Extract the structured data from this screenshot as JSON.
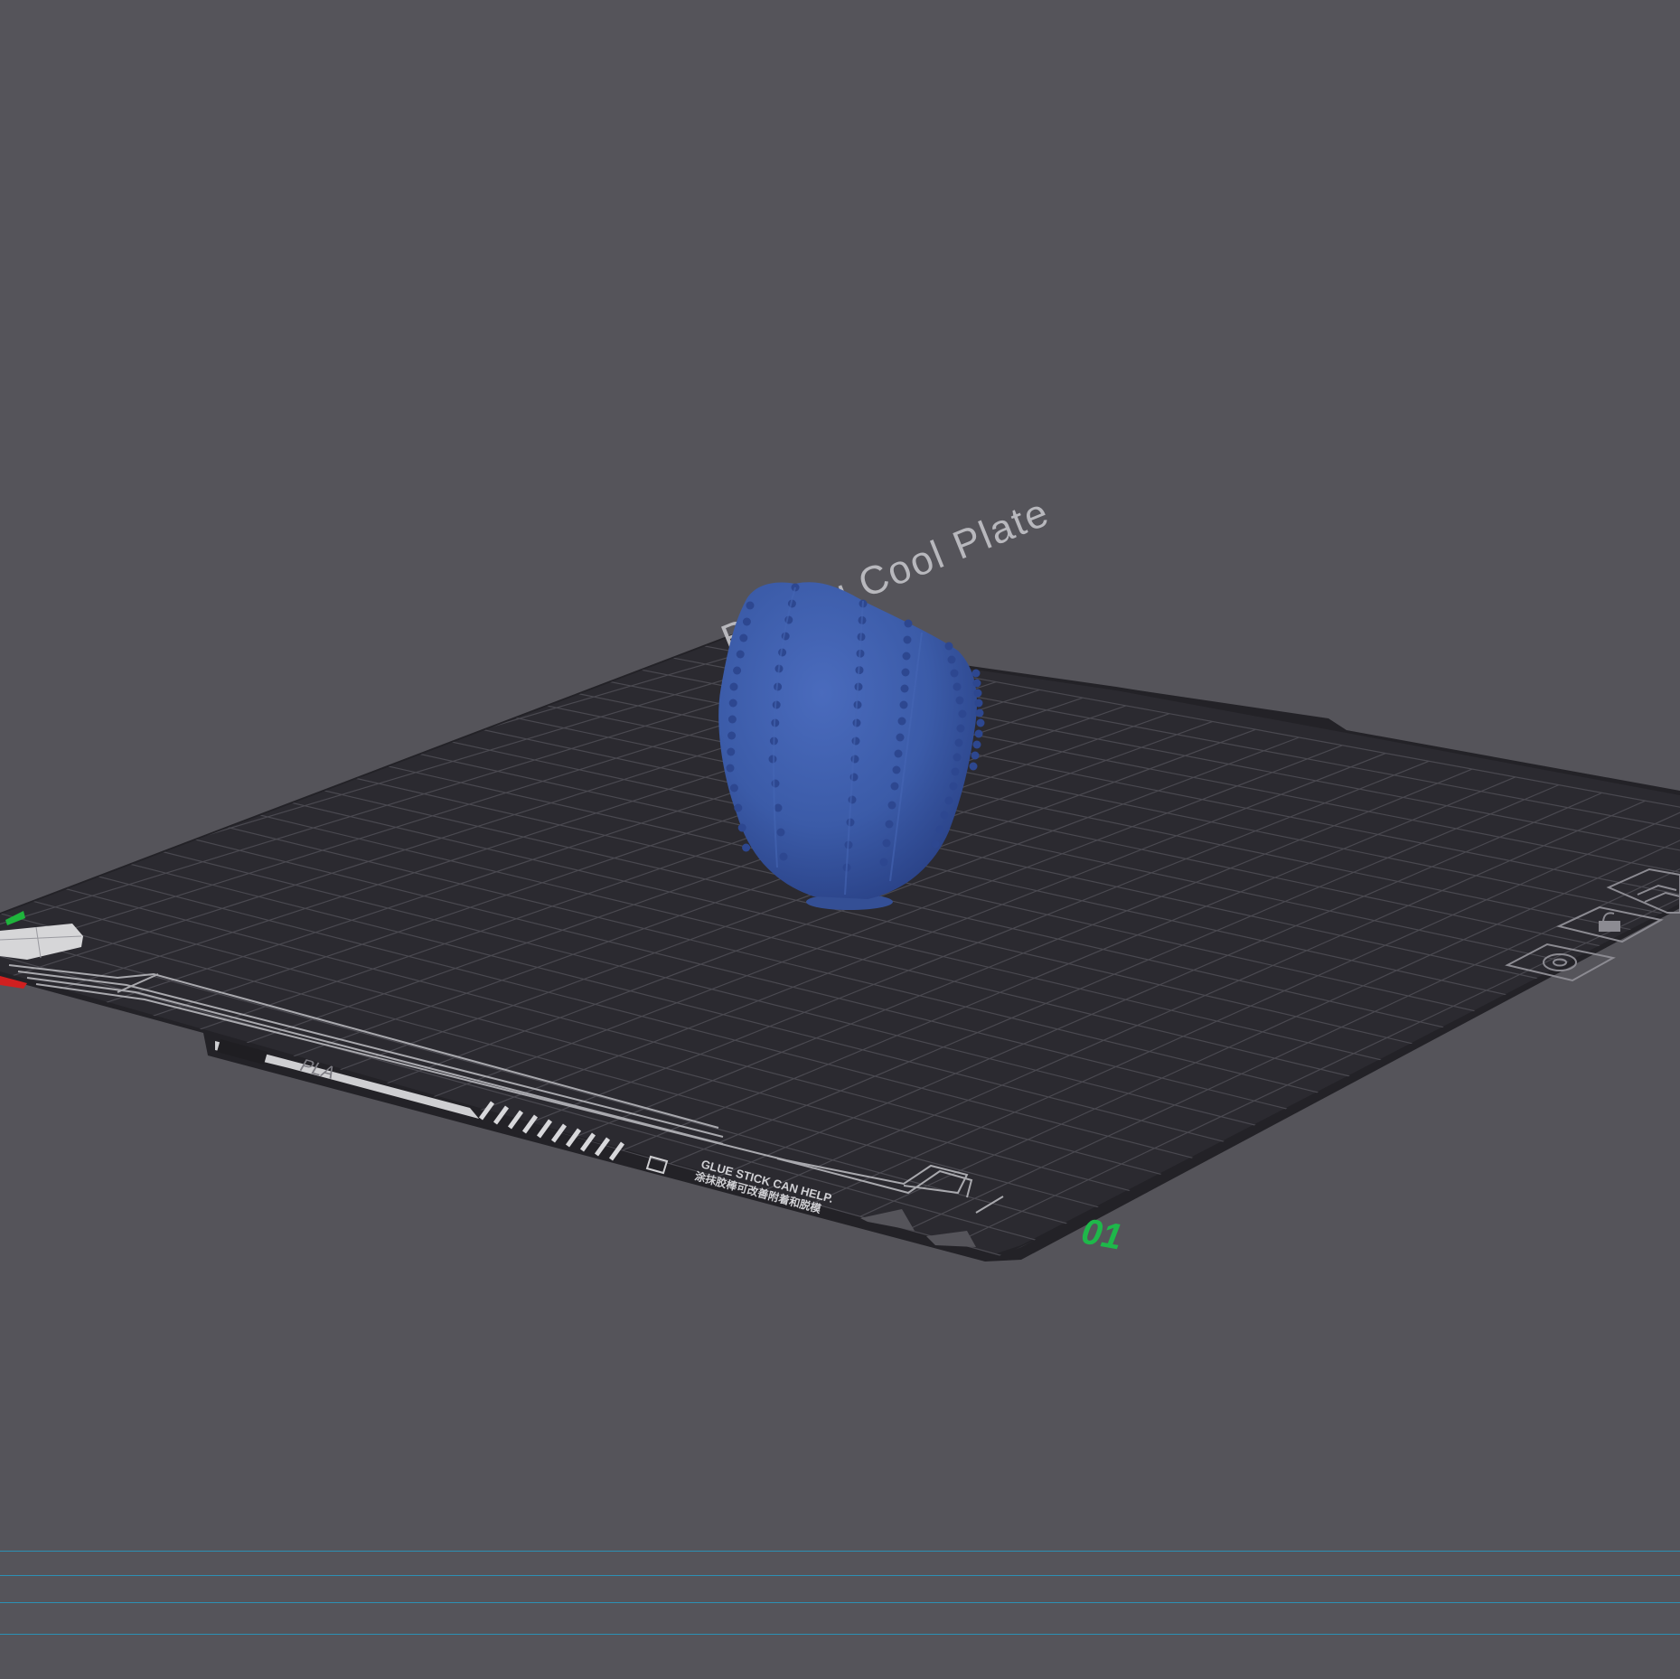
{
  "viewport": {
    "background": "#55545a"
  },
  "plate": {
    "title": "Bambu Cool Plate",
    "material_label": "PLA",
    "hint_en": "GLUE STICK CAN HELP.",
    "hint_cn": "涂抹胶棒可改善附着和脱模",
    "plate_number": "01",
    "plate_color": "#2b2a30",
    "grid_color": "#4a4950",
    "number_color": "#1eb84a"
  },
  "model": {
    "name": "textured-cactus-model",
    "color": "#3b5ba8"
  },
  "plate_controls": [
    {
      "name": "plate-settings-button",
      "icon": "gear-icon"
    },
    {
      "name": "plate-lock-button",
      "icon": "lock-icon"
    },
    {
      "name": "plate-arrange-button",
      "icon": "arrange-icon"
    }
  ]
}
